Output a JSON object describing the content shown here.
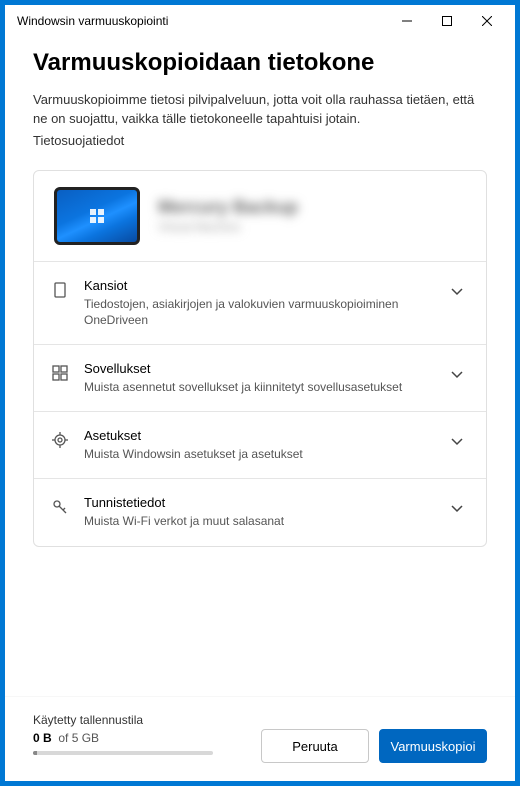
{
  "titlebar": {
    "title": "Windowsin varmuuskopiointi"
  },
  "header": {
    "heading": "Varmuuskopioidaan tietokone"
  },
  "intro": {
    "text": "Varmuuskopioimme tietosi pilvipalveluun, jotta voit olla rauhassa tietäen, että ne on suojattu, vaikka tälle tietokoneelle tapahtuisi jotain.",
    "privacy": "Tietosuojatiedot"
  },
  "device": {
    "name": "Mercury Backup",
    "subtitle": "Virtual Machine"
  },
  "sections": [
    {
      "icon": "folder-outline-icon",
      "title": "Kansiot",
      "desc": "Tiedostojen, asiakirjojen ja valokuvien varmuuskopioiminen OneDriveen"
    },
    {
      "icon": "apps-grid-icon",
      "title": "Sovellukset",
      "desc": "Muista asennetut sovellukset ja kiinnitetyt sovellusasetukset"
    },
    {
      "icon": "gear-icon",
      "title": "Asetukset",
      "desc": "Muista Windowsin asetukset ja asetukset"
    },
    {
      "icon": "key-icon",
      "title": "Tunnistetiedot",
      "desc": "Muista Wi-Fi verkot ja muut salasanat"
    }
  ],
  "storage": {
    "label": "Käytetty tallennustila",
    "used": "0 B",
    "of": "of",
    "total": "5 GB"
  },
  "buttons": {
    "cancel": "Peruuta",
    "backup": "Varmuuskopioi"
  }
}
